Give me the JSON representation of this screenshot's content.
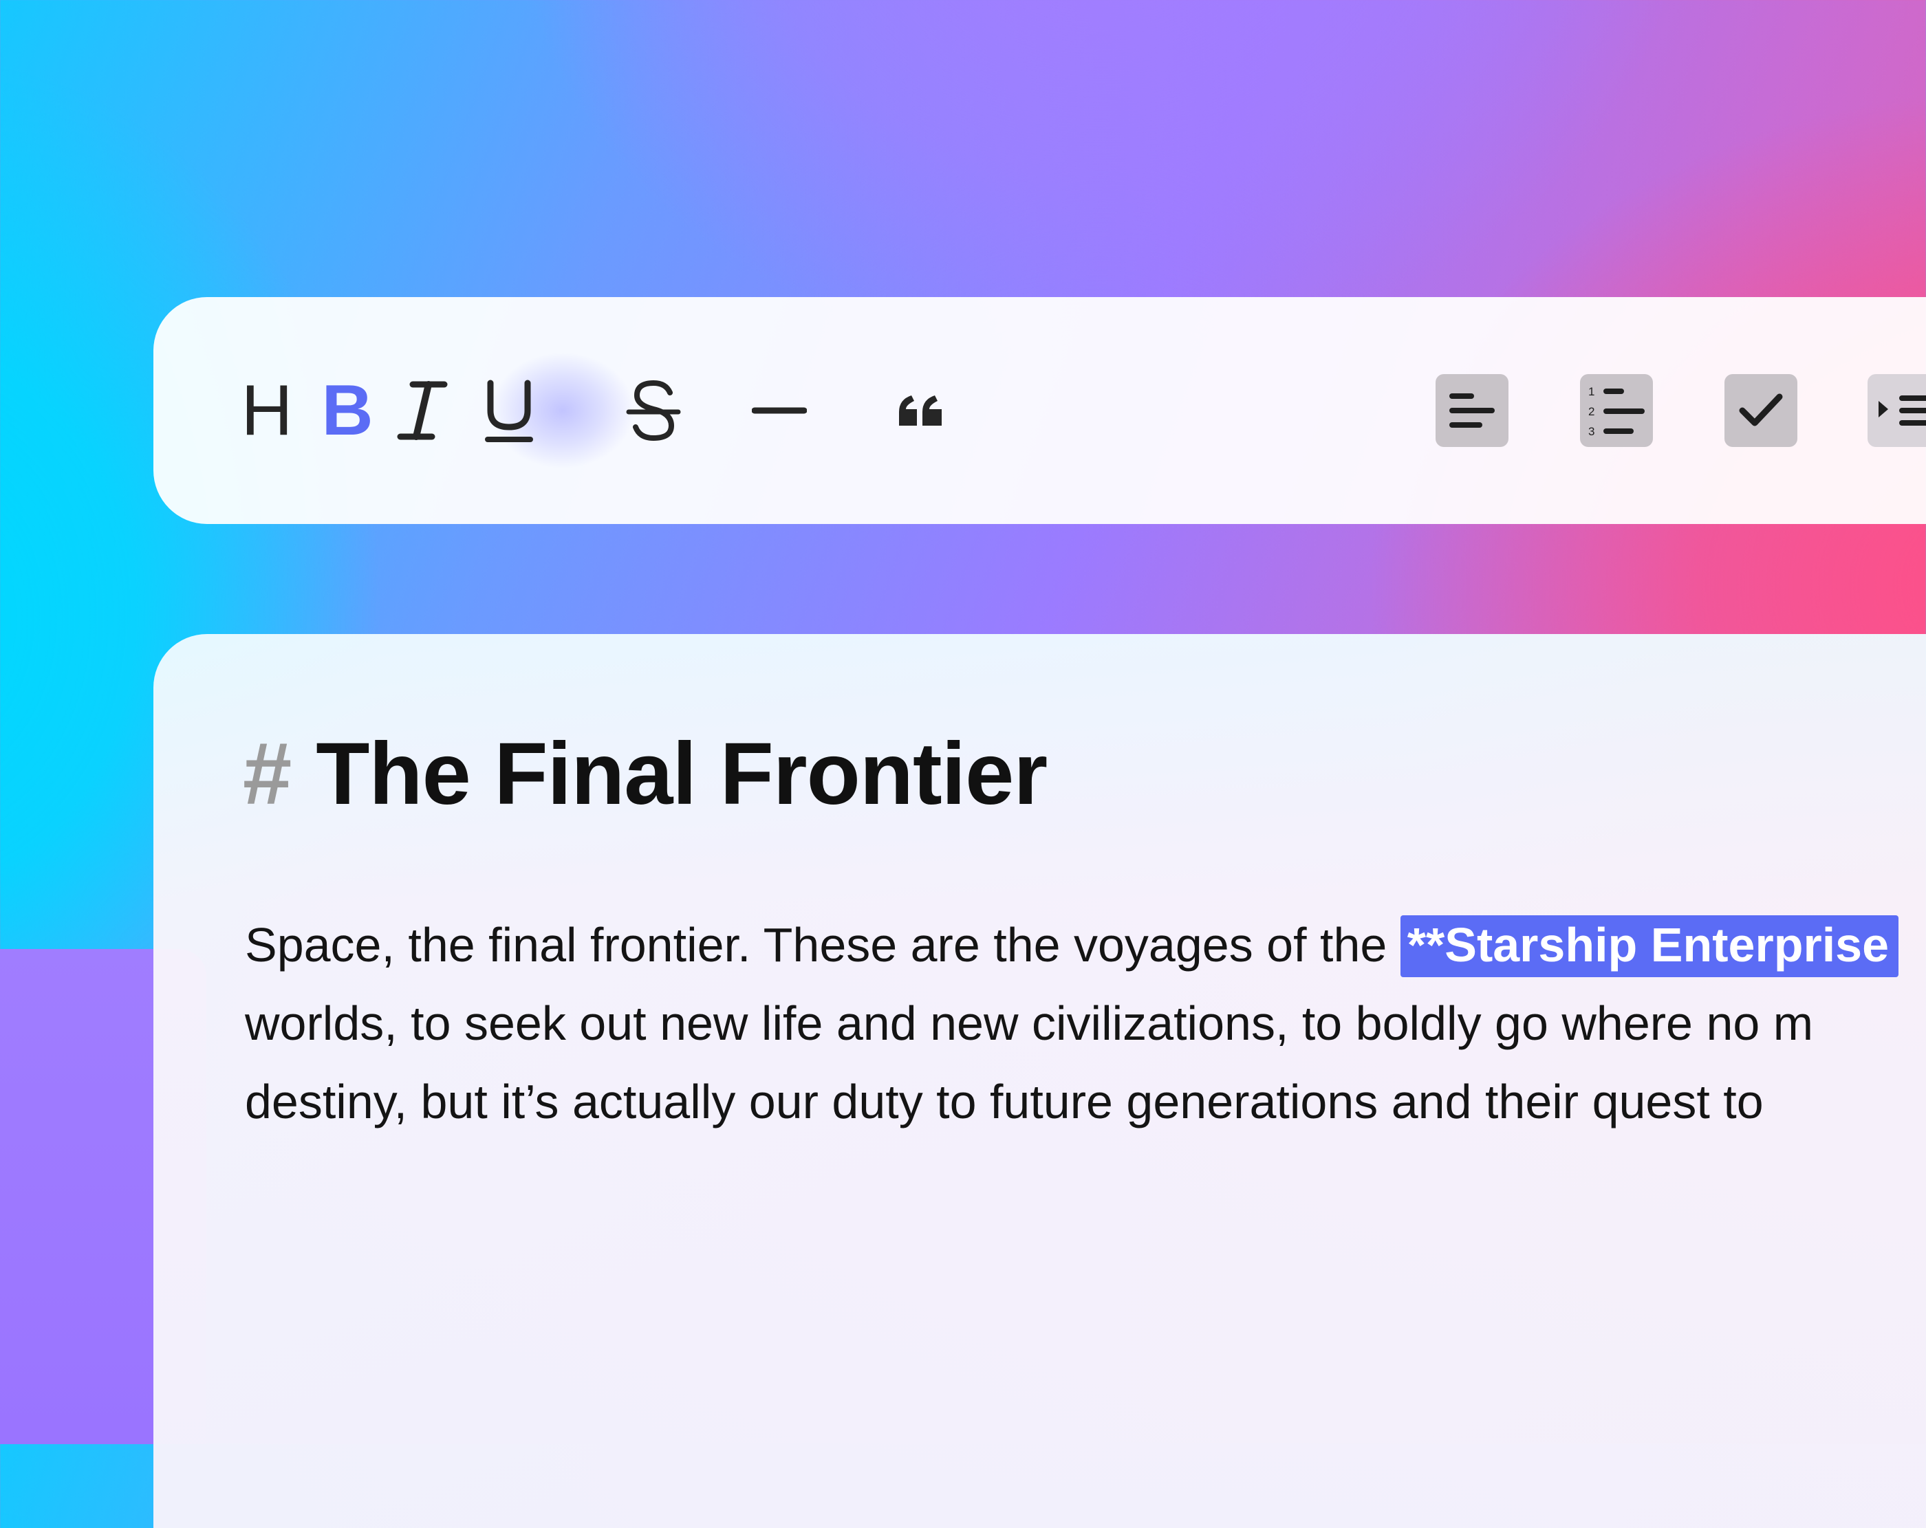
{
  "colors": {
    "accent": "#5b6cf5",
    "bold_active": "#5b6cf5",
    "selection_bg": "#5b6cf5",
    "heading_marker": "#9a9a9a",
    "icon": "#262626",
    "icon_tile": "#c8c3c8"
  },
  "toolbar": {
    "heading": {
      "label": "H",
      "icon": "heading-icon"
    },
    "bold": {
      "label": "B",
      "icon": "bold-icon",
      "active": true
    },
    "italic": {
      "icon": "italic-icon"
    },
    "underline": {
      "icon": "underline-icon"
    },
    "strikethrough": {
      "icon": "strikethrough-icon"
    },
    "divider": {
      "icon": "horizontal-rule-icon"
    },
    "quote": {
      "icon": "blockquote-icon"
    },
    "bullet_list": {
      "icon": "bullet-list-icon"
    },
    "numbered_list": {
      "icon": "numbered-list-icon",
      "numbers": [
        "1",
        "2",
        "3"
      ]
    },
    "checklist": {
      "icon": "checkbox-icon"
    },
    "indent": {
      "icon": "indent-icon"
    }
  },
  "editor": {
    "heading_marker": "#",
    "heading_text": "The Final Frontier",
    "lines": [
      "Space, the final frontier. These are the voyages of the ",
      "worlds, to seek out new life and new civilizations, to boldly go where no m",
      "destiny, but it’s actually our duty to future generations and their quest to"
    ],
    "selected_text": "**Starship Enterprise"
  }
}
